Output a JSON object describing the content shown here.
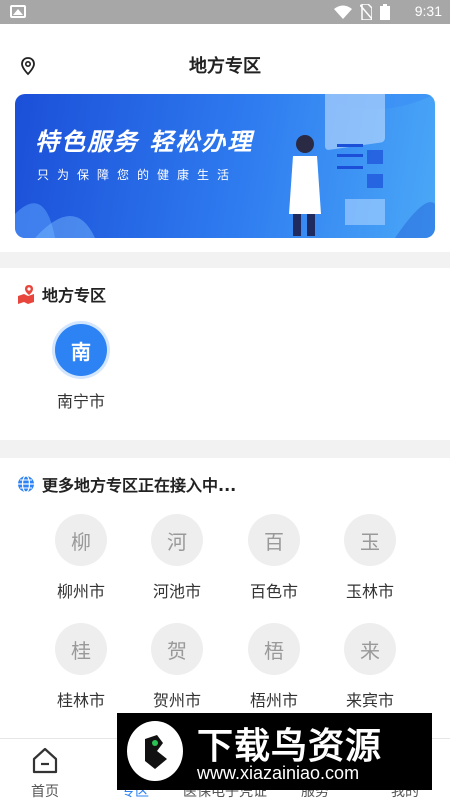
{
  "status_bar": {
    "time": "9:31"
  },
  "header": {
    "title": "地方专区"
  },
  "banner": {
    "headline": "特色服务 轻松办理",
    "subline": "只为保障您的健康生活"
  },
  "section_local": {
    "title": "地方专区",
    "cities": [
      {
        "char": "南",
        "name": "南宁市"
      }
    ]
  },
  "section_more": {
    "title": "更多地方专区正在接入中...",
    "cities": [
      {
        "char": "柳",
        "name": "柳州市"
      },
      {
        "char": "河",
        "name": "河池市"
      },
      {
        "char": "百",
        "name": "百色市"
      },
      {
        "char": "玉",
        "name": "玉林市"
      },
      {
        "char": "桂",
        "name": "桂林市"
      },
      {
        "char": "贺",
        "name": "贺州市"
      },
      {
        "char": "梧",
        "name": "梧州市"
      },
      {
        "char": "来",
        "name": "来宾市"
      }
    ]
  },
  "tabbar": {
    "tabs": [
      {
        "label": "首页"
      },
      {
        "label": "专区"
      },
      {
        "label": "医保电子凭证"
      },
      {
        "label": "服务"
      },
      {
        "label": "我的"
      }
    ]
  },
  "watermark": {
    "brand": "下载鸟资源",
    "url": "www.xiazainiao.com"
  },
  "colors": {
    "accent": "#2d83f3",
    "banner_start": "#1b4fd8",
    "banner_end": "#4aa8f7",
    "section_icon": "#e8453c"
  }
}
